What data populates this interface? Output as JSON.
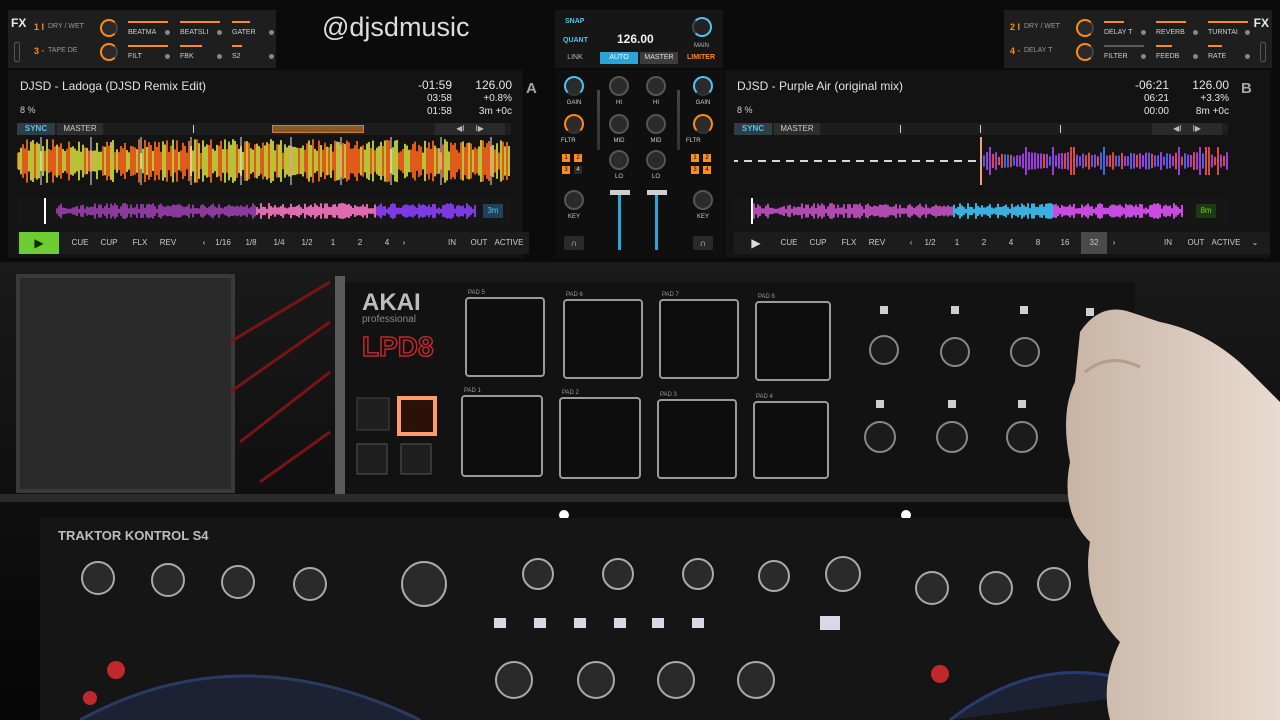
{
  "watermark": "@djsdmusic",
  "fx_left": {
    "label": "FX",
    "unit1": {
      "number": "1 I",
      "mode": "DRY / WET",
      "slots": [
        "BEATMA",
        "BEATSLI",
        "GATER"
      ]
    },
    "unit2": {
      "number": "3 ·",
      "mode": "TAPE DE",
      "slots": [
        "FILT",
        "FBK",
        "S2"
      ]
    }
  },
  "fx_right": {
    "label": "FX",
    "unit1": {
      "number": "2 I",
      "mode": "DRY / WET",
      "slots": [
        "DELAY T",
        "REVERB",
        "TURNTAI"
      ]
    },
    "unit2": {
      "number": "4 ·",
      "mode": "DELAY T",
      "slots": [
        "FILTER",
        "FEEDB",
        "RATE"
      ]
    }
  },
  "master": {
    "snap": "SNAP",
    "quant": "QUANT",
    "tempo": "126.00",
    "main": "MAIN",
    "link": "LINK",
    "auto": "AUTO",
    "master": "MASTER",
    "limiter": "LIMITER"
  },
  "deck_a": {
    "letter": "A",
    "title": "DJSD - Ladoga (DJSD Remix Edit)",
    "sub": "8 %",
    "time_remaining": "-01:59",
    "time_elapsed": "03:58",
    "time_total": "01:58",
    "bpm": "126.00",
    "pitch": "+0.8%",
    "offset": "3m +0c",
    "sync": "SYNC",
    "master": "MASTER",
    "loop_counter": "3m",
    "buttons": {
      "cue": "CUE",
      "cup": "CUP",
      "flx": "FLX",
      "rev": "REV"
    },
    "loop_sizes": [
      "1/16",
      "1/8",
      "1/4",
      "1/2",
      "1",
      "2",
      "4"
    ],
    "right_buttons": {
      "in": "IN",
      "out": "OUT",
      "active": "ACTIVE"
    },
    "playing": true
  },
  "deck_b": {
    "letter": "B",
    "title": "DJSD - Purple Air (original mix)",
    "sub": "8 %",
    "time_remaining": "-06:21",
    "time_elapsed": "06:21",
    "time_total": "00:00",
    "bpm": "126.00",
    "pitch": "+3.3%",
    "offset": "8m +0c",
    "sync": "SYNC",
    "master": "MASTER",
    "loop_counter": "8m",
    "buttons": {
      "cue": "CUE",
      "cup": "CUP",
      "flx": "FLX",
      "rev": "REV"
    },
    "loop_sizes": [
      "1/2",
      "1",
      "2",
      "4",
      "8",
      "16",
      "32"
    ],
    "selected_loop": "32",
    "right_buttons": {
      "in": "IN",
      "out": "OUT",
      "active": "ACTIVE"
    },
    "playing": false
  },
  "mixer": {
    "gain": "GAIN",
    "hi": "HI",
    "mid": "MID",
    "lo": "LO",
    "fltr": "FLTR",
    "key": "KEY",
    "cue_digits": [
      "1",
      "2",
      "3",
      "4"
    ]
  },
  "hardware": {
    "brand": "AKAI",
    "brand_sub": "professional",
    "model": "LPD8",
    "pad_labels": [
      "PAD 5",
      "PAD 6",
      "PAD 7",
      "PAD 8",
      "PAD 1",
      "PAD 2",
      "PAD 3",
      "PAD 4"
    ],
    "controller": "TRAKTOR KONTROL S4"
  },
  "colors": {
    "accent_blue": "#4fc4f0",
    "accent_orange": "#ff8b1a",
    "play_green": "#6dcc2f"
  }
}
